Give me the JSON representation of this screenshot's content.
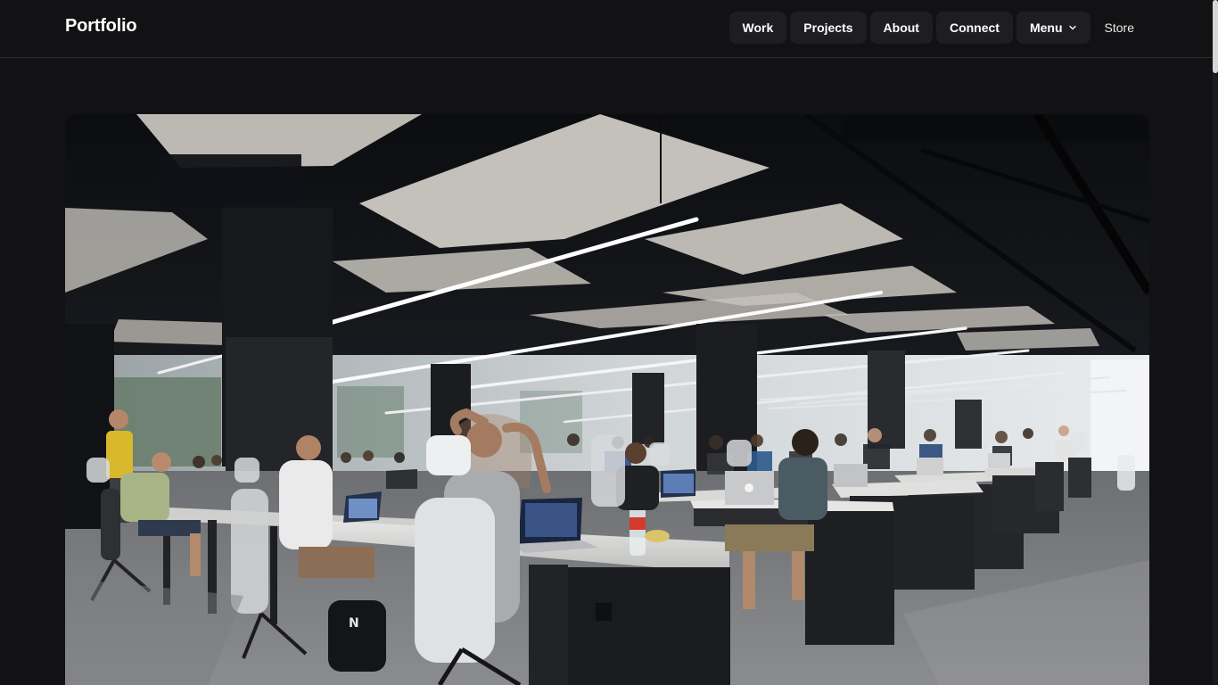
{
  "header": {
    "brand": "Portfolio",
    "nav": [
      {
        "label": "Work"
      },
      {
        "label": "Projects"
      },
      {
        "label": "About"
      },
      {
        "label": "Connect"
      },
      {
        "label": "Menu"
      }
    ],
    "store_label": "Store"
  },
  "hero": {
    "icon": "office-photo",
    "subject": "open-plan office with rows of desks and people working on laptops"
  },
  "colors": {
    "background": "#121214",
    "nav_button": "#1e1e22",
    "text": "#ffffff"
  }
}
